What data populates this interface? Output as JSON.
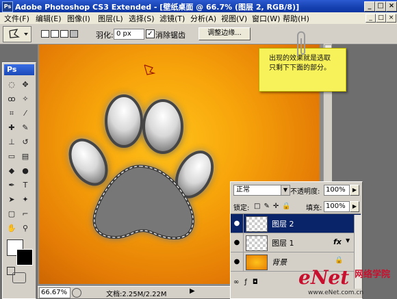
{
  "app": {
    "badge": "Ps",
    "title": "Adobe Photoshop CS3 Extended - [壁纸桌面 @ 66.7% (图层 2, RGB/8)]",
    "window_buttons": [
      "_",
      "□",
      "×"
    ]
  },
  "menu": {
    "items": [
      "文件(F)",
      "编辑(E)",
      "图像(I)",
      "图层(L)",
      "选择(S)",
      "滤镜(T)",
      "分析(A)",
      "视图(V)",
      "窗口(W)",
      "帮助(H)"
    ]
  },
  "options": {
    "feather_label": "羽化:",
    "feather_value": "0 px",
    "antialias_label": "消除锯齿",
    "antialias_checked": true,
    "refine_edge": "调整边缘..."
  },
  "toolbox": {
    "header": "Ps",
    "tools": [
      "marquee-icon",
      "move-icon",
      "lasso-icon",
      "magic-wand-icon",
      "crop-icon",
      "slice-icon",
      "healing-icon",
      "brush-icon",
      "stamp-icon",
      "history-brush-icon",
      "eraser-icon",
      "gradient-icon",
      "blur-icon",
      "dodge-icon",
      "pen-icon",
      "type-icon",
      "path-select-icon",
      "shape-icon",
      "notes-icon",
      "eyedropper-icon",
      "hand-icon",
      "zoom-icon"
    ]
  },
  "note": {
    "line1": "出现的效果就是选取",
    "line2": "只剩下下面的部分。"
  },
  "status": {
    "zoom": "66.67%",
    "doc": "文档:2.25M/2.22M"
  },
  "layers": {
    "blend_mode": "正常",
    "opacity_label": "不透明度:",
    "opacity_value": "100%",
    "lock_label": "锁定:",
    "fill_label": "填充:",
    "fill_value": "100%",
    "rows": [
      {
        "name": "图层 2",
        "selected": true
      },
      {
        "name": "图层 1",
        "fx": "fx"
      },
      {
        "name": "背景",
        "locked": true
      }
    ]
  },
  "watermark": {
    "brand": "eNet",
    "cn": "网络学院",
    "url": "www.eNet.com.cn"
  },
  "colors": {
    "titlebar": "#1541b0",
    "canvas_orange": "#f7a40a",
    "note_yellow": "#f7f25a",
    "selected_layer": "#0a246a"
  }
}
